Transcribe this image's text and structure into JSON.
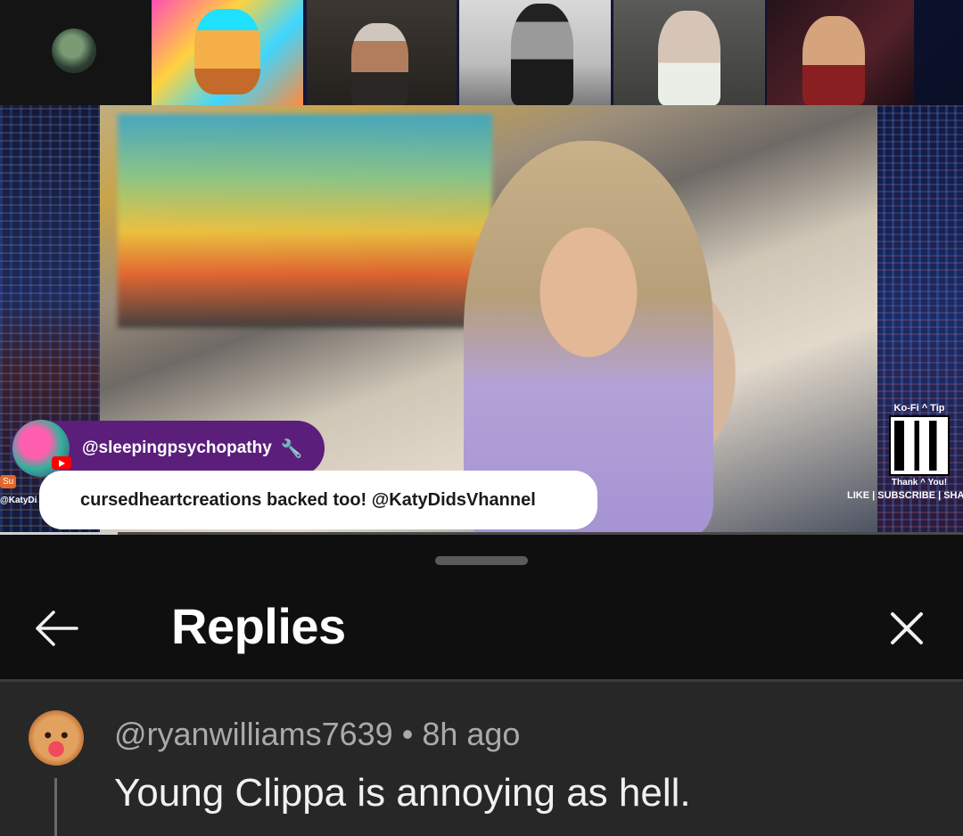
{
  "video": {
    "superchat_handle": "@sleepingpsychopathy",
    "superchat_message": "cursedheartcreations backed too! @KatyDidsVhannel",
    "side_tag_top": "Su",
    "side_tag_bottom": "@KatyDi",
    "kofi_label": "Ko-Fi ^ Tip",
    "kofi_thanks": "Thank ^ You!",
    "promo_line": "LIKE | SUBSCRIBE | SHAR",
    "progress_fraction": 0.122
  },
  "sheet": {
    "title": "Replies"
  },
  "reply": {
    "author": "@ryanwilliams7639",
    "separator": "•",
    "time": "8h ago",
    "text": "Young Clippa is annoying as hell."
  },
  "colors": {
    "background": "#0f0f0f",
    "reply_background": "#272727",
    "superchat_purple": "#5b1e7a",
    "meta_gray": "#aaaaaa"
  }
}
